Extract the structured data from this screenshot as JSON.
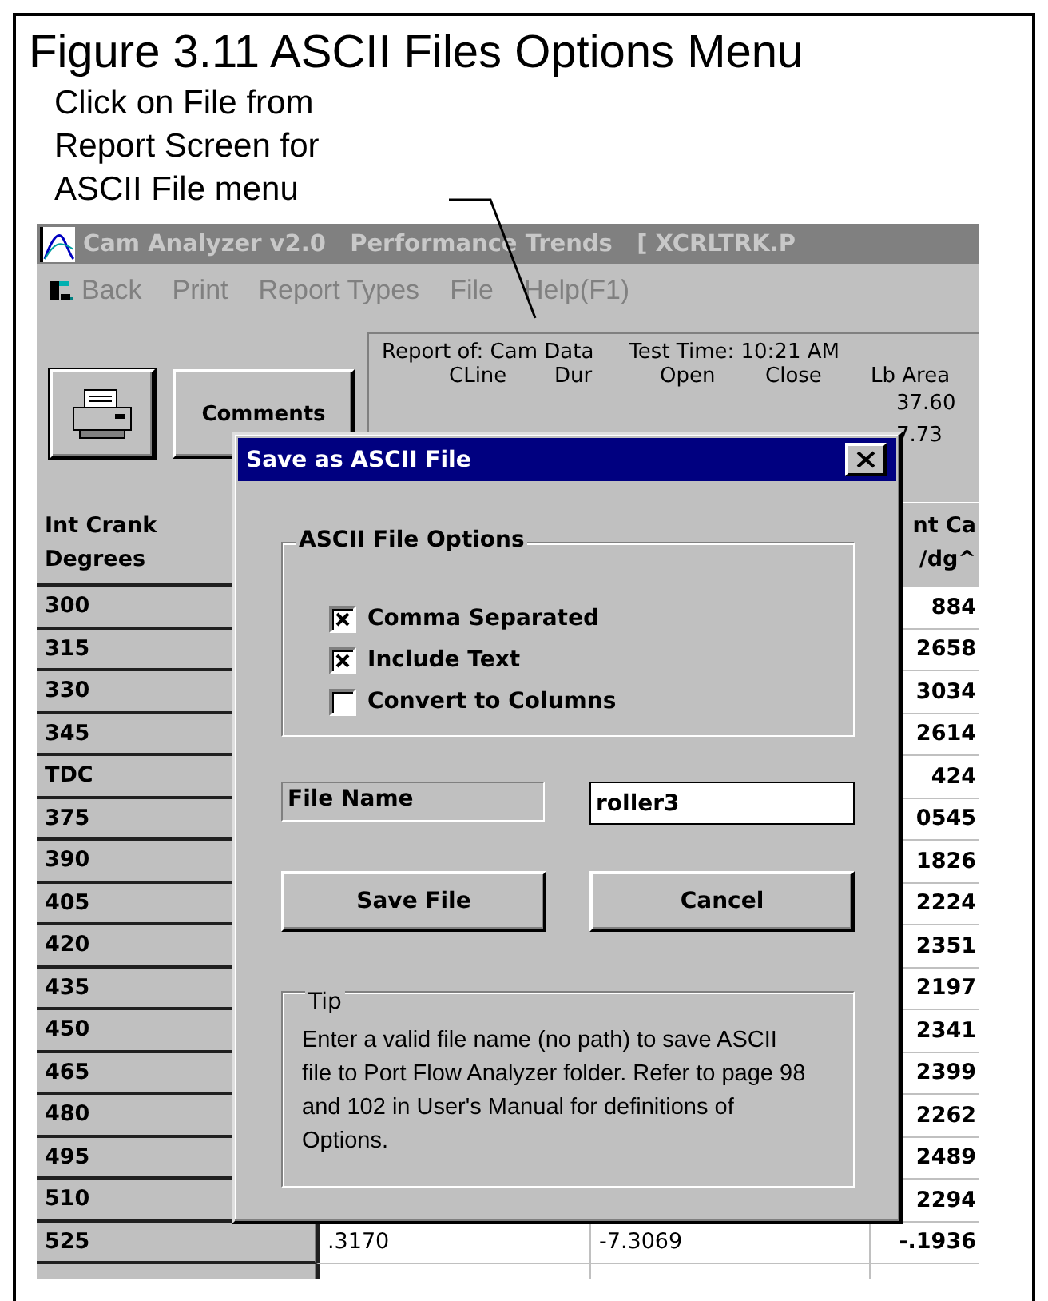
{
  "figure": {
    "title": "Figure 3.11 ASCII Files Options Menu",
    "caption": [
      "Click on File from",
      "Report Screen for",
      "ASCII File menu"
    ]
  },
  "window": {
    "title": "Cam Analyzer v2.0   Performance Trends   [ XCRLTRK.P"
  },
  "menu": [
    {
      "label": "Back"
    },
    {
      "label": "Print"
    },
    {
      "label": "Report Types"
    },
    {
      "label": "File"
    },
    {
      "label": "Help(F1)"
    }
  ],
  "toolbar": {
    "comments_button": "Comments"
  },
  "report_info": {
    "report_of": "Report of:  Cam Data",
    "test_time": "Test Time: 10:21 AM",
    "columns": [
      "CLine",
      "Dur",
      "Open",
      "Close",
      "Lb Area"
    ],
    "values": [
      "37.60",
      "7.73"
    ]
  },
  "table": {
    "column_1": [
      "Int  Crank",
      "Degrees"
    ],
    "column_4": [
      "nt Ca",
      "/dg^"
    ],
    "rows": [
      {
        "degrees": "300",
        "column_4": "884"
      },
      {
        "degrees": "315",
        "column_4": "2658"
      },
      {
        "degrees": "330",
        "column_4": "3034"
      },
      {
        "degrees": "345",
        "column_4": "2614"
      },
      {
        "degrees": "TDC",
        "column_4": "424"
      },
      {
        "degrees": "375",
        "column_4": "0545"
      },
      {
        "degrees": "390",
        "column_4": "1826"
      },
      {
        "degrees": "405",
        "column_4": "2224"
      },
      {
        "degrees": "420",
        "column_4": "2351"
      },
      {
        "degrees": "435",
        "column_4": "2197"
      },
      {
        "degrees": "450",
        "column_4": "2341"
      },
      {
        "degrees": "465",
        "column_4": "2399"
      },
      {
        "degrees": "480",
        "column_4": "2262"
      },
      {
        "degrees": "495",
        "column_4": "2489"
      },
      {
        "degrees": "510",
        "column_4": "2294"
      },
      {
        "degrees": "525",
        "column_2": ".3170",
        "column_3": "-7.3069",
        "column_4": "-.1936"
      }
    ]
  },
  "dialog": {
    "title": "Save as ASCII File",
    "options_group": {
      "title": "ASCII File Options",
      "options": [
        {
          "label": "Comma Separated",
          "checked": true
        },
        {
          "label": "Include Text",
          "checked": true
        },
        {
          "label": "Convert to Columns",
          "checked": false
        }
      ]
    },
    "file_name": {
      "label": "File Name",
      "value": "roller3"
    },
    "buttons": [
      "Save File",
      "Cancel"
    ],
    "tip": {
      "title": "Tip",
      "text": "Enter a valid file name (no path) to save ASCII file to Port Flow Analyzer folder. Refer to page 98 and 102 in User's Manual for definitions of Options."
    }
  }
}
